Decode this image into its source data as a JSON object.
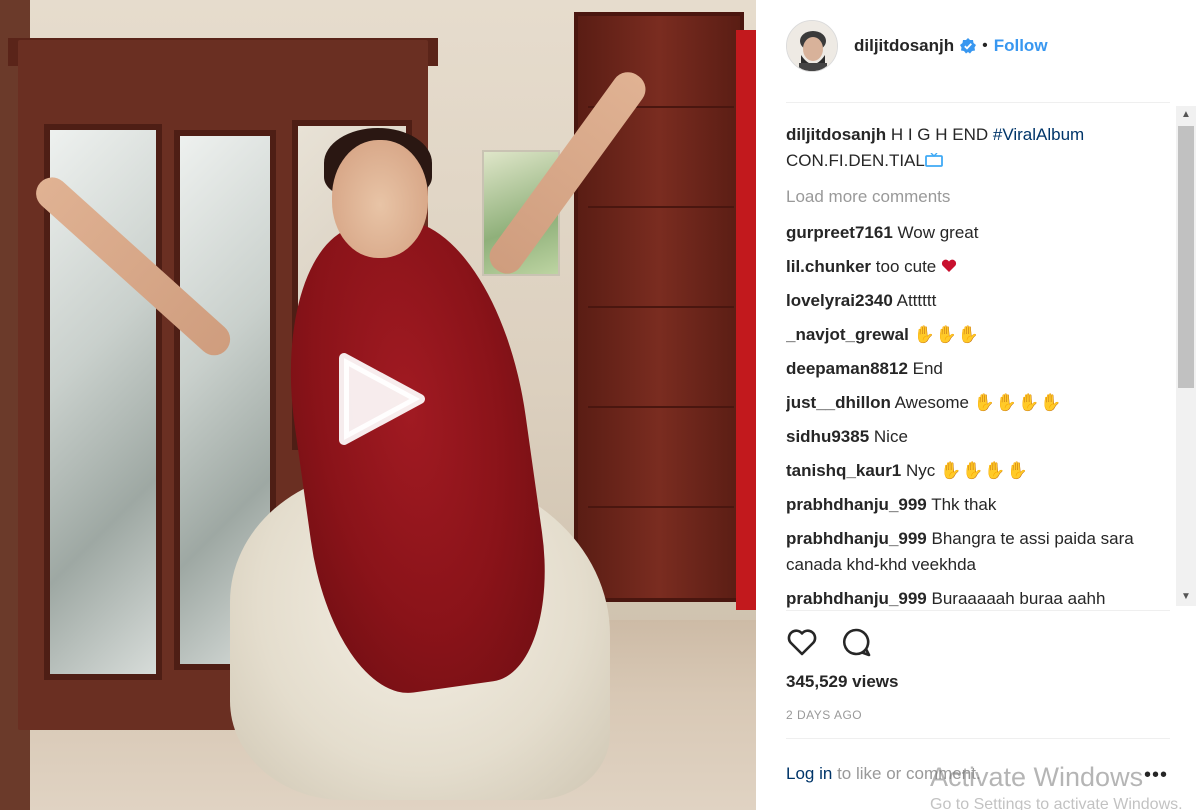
{
  "post": {
    "username": "diljitdosanjh",
    "follow_label": "Follow",
    "separator": "•",
    "caption_text": "H I G H END",
    "caption_hashtag": "#ViralAlbum",
    "caption_line2": "CON.FI.DEN.TIAL",
    "caption_emoji": "tv-icon",
    "load_more": "Load more comments",
    "views": "345,529 views",
    "timestamp": "2 DAYS AGO",
    "login_link": "Log in",
    "login_text": "to like or comment."
  },
  "comments": [
    {
      "user": "gurpreet7161",
      "text": "Wow great"
    },
    {
      "user": "lil.chunker",
      "text": "too cute",
      "emoji": "heart"
    },
    {
      "user": "lovelyrai2340",
      "text": "Atttttt"
    },
    {
      "user": "_navjot_grewal",
      "text": "",
      "emoji": "clap×3"
    },
    {
      "user": "deepaman8812",
      "text": "End"
    },
    {
      "user": "just__dhillon",
      "text": "Awesome",
      "emoji": "clap×4"
    },
    {
      "user": "sidhu9385",
      "text": "Nice"
    },
    {
      "user": "tanishq_kaur1",
      "text": "Nyc",
      "emoji": "clap×4"
    },
    {
      "user": "prabhdhanju_999",
      "text": "Thk thak"
    },
    {
      "user": "prabhdhanju_999",
      "text": "Bhangra te assi paida sara canada khd-khd veekhda"
    },
    {
      "user": "prabhdhanju_999",
      "text": "Buraaaaah buraa aahh"
    }
  ],
  "overlay": {
    "watermark_title": "Activate Windows",
    "watermark_sub": "Go to Settings to activate Windows."
  },
  "colors": {
    "link": "#3897f0",
    "hashtag": "#003569",
    "muted": "#999999",
    "heart": "#ed1c24"
  }
}
